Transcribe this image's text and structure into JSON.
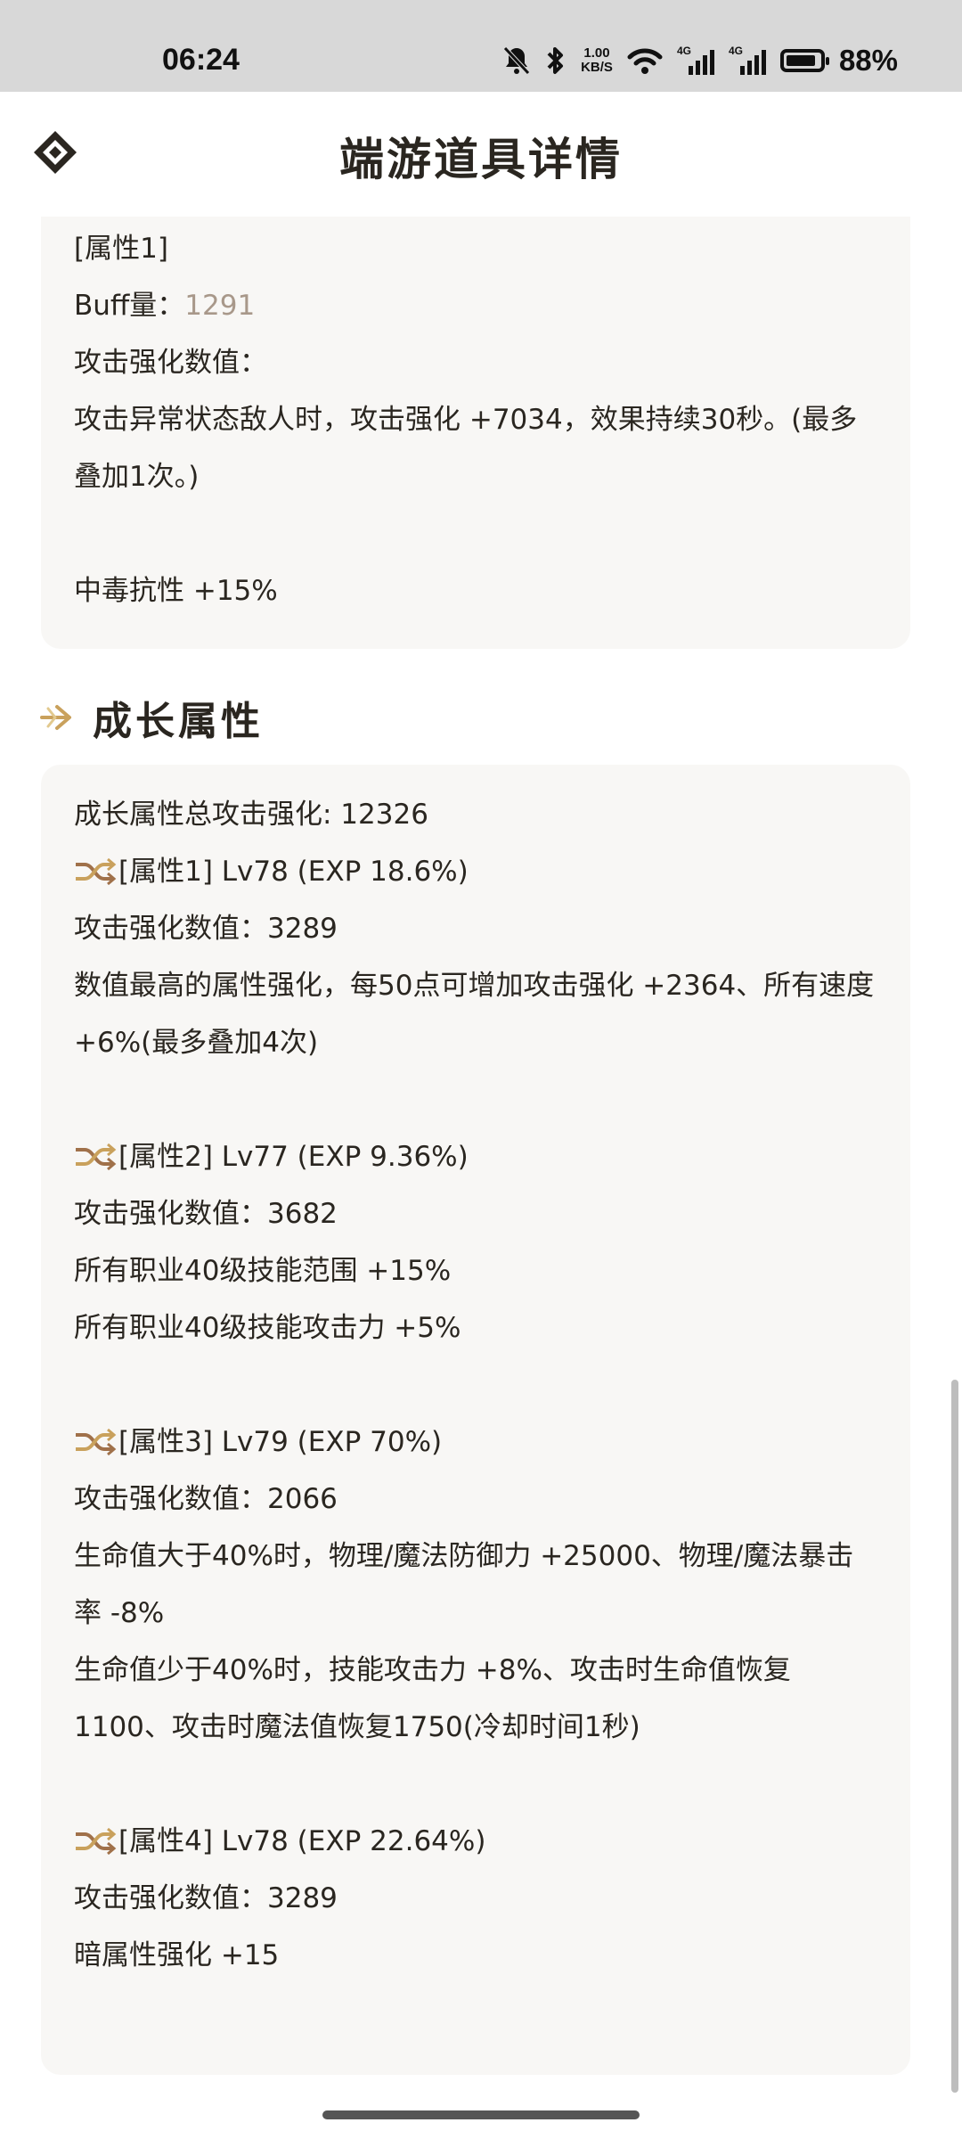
{
  "status_bar": {
    "time": "06:24",
    "net_speed_top": "1.00",
    "net_speed_bottom": "KB/S",
    "signal_1_label": "4G",
    "signal_2_label": "4G",
    "battery_level": 0.88,
    "battery_text": "88%",
    "icons": [
      "mute-icon",
      "bluetooth-icon",
      "wifi-icon",
      "signal-icon",
      "battery-icon"
    ]
  },
  "header": {
    "title": "端游道具详情",
    "logo_icon": "diamond-logo-icon"
  },
  "top_card": {
    "lines": [
      "[属性1]",
      "攻击强化数值：",
      "攻击异常状态敌人时，攻击强化 +7034，效果持续30秒。(最多叠加1次。)",
      "中毒抗性 +15%"
    ],
    "buff_label": "Buff量：",
    "buff_value": "1291"
  },
  "growth_section": {
    "title": "成长属性",
    "total": "成长属性总攻击强化: 12326",
    "attrs": [
      {
        "header": "[属性1] Lv78 (EXP 18.6%)",
        "value": "攻击强化数值：3289",
        "effects": [
          "数值最高的属性强化，每50点可增加攻击强化 +2364、所有速度 +6%(最多叠加4次)"
        ]
      },
      {
        "header": "[属性2] Lv77 (EXP 9.36%)",
        "value": "攻击强化数值：3682",
        "effects": [
          "所有职业40级技能范围 +15%",
          "所有职业40级技能攻击力 +5%"
        ]
      },
      {
        "header": "[属性3] Lv79 (EXP 70%)",
        "value": "攻击强化数值：2066",
        "effects": [
          "生命值大于40%时，物理/魔法防御力 +25000、物理/魔法暴击率 -8%",
          "生命值少于40%时，技能攻击力 +8%、攻击时生命值恢复1100、攻击时魔法值恢复1750(冷却时间1秒)"
        ]
      },
      {
        "header": "[属性4] Lv78 (EXP 22.64%)",
        "value": "攻击强化数值：3289",
        "effects": [
          "暗属性强化 +15"
        ]
      }
    ]
  },
  "colors": {
    "accent_gold": "#c9a15c",
    "shuffle_brown": "#a0714a",
    "card_bg": "#f8f7f5",
    "text": "#2a2620"
  }
}
